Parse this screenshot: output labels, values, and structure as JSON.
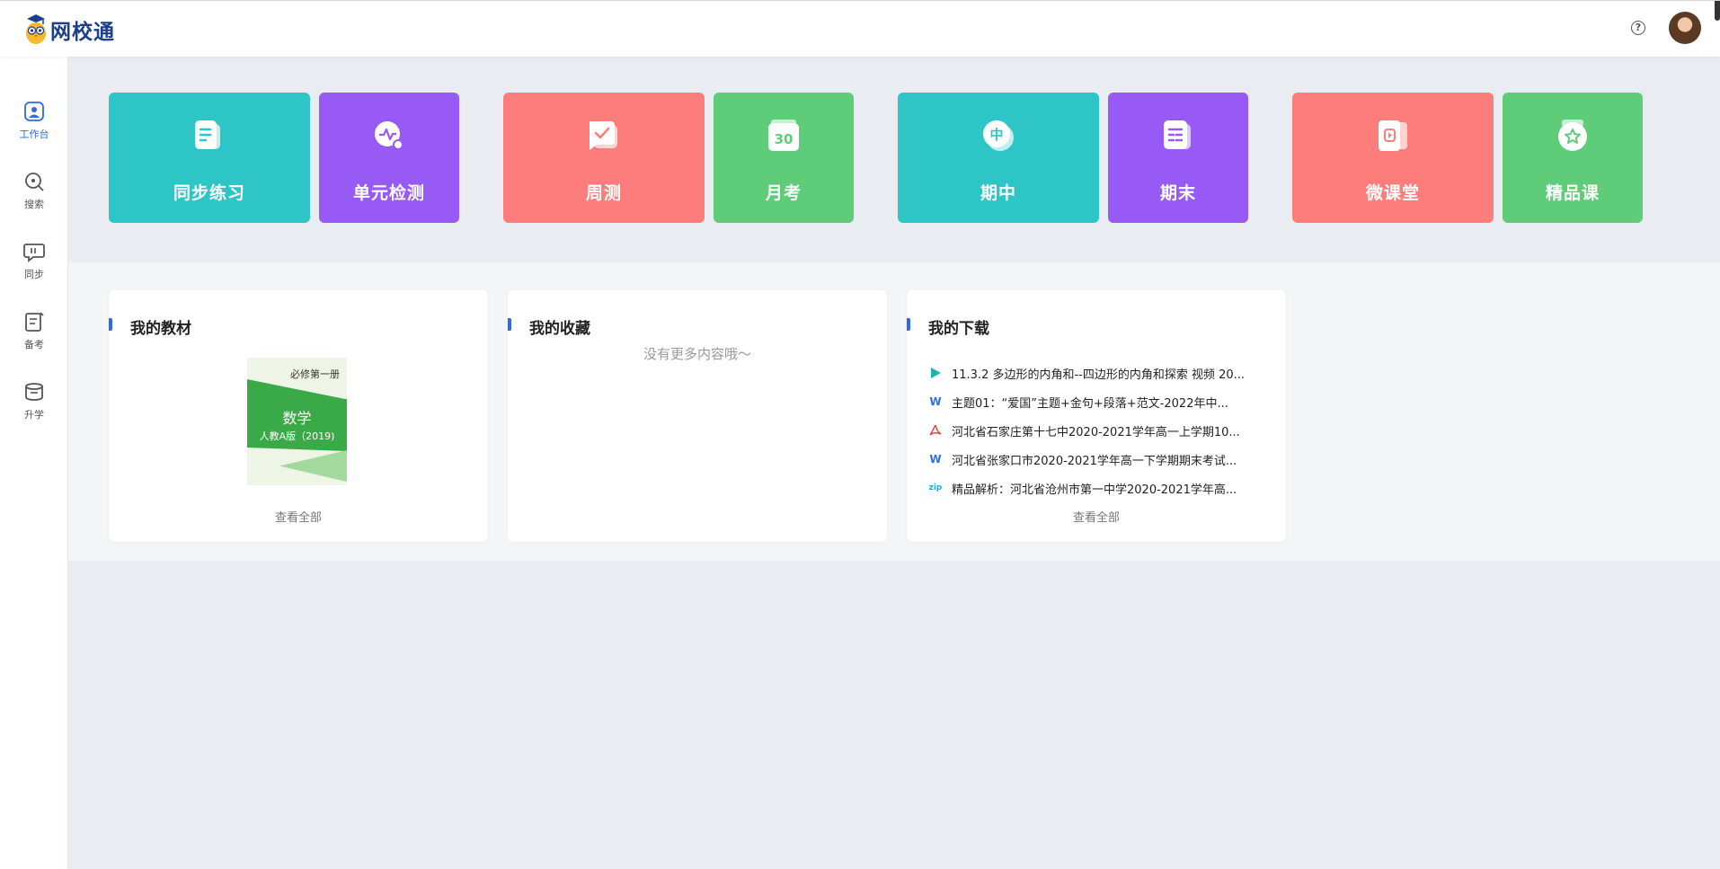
{
  "header": {
    "logo_text": "网校通",
    "help_glyph": "?"
  },
  "sidebar": {
    "items": [
      {
        "label": "工作台",
        "icon": "workbench-icon",
        "active": true
      },
      {
        "label": "搜索",
        "icon": "search-icon"
      },
      {
        "label": "同步",
        "icon": "sync-chat-icon"
      },
      {
        "label": "备考",
        "icon": "exam-prep-icon"
      },
      {
        "label": "升学",
        "icon": "graduation-icon"
      }
    ]
  },
  "tiles": [
    {
      "label": "同步练习",
      "color": "#2ec5c7",
      "icon": "document-icon"
    },
    {
      "label": "单元检测",
      "color": "#975af5",
      "icon": "chart-search-icon"
    },
    {
      "label": "周测",
      "color": "#fc7d7b",
      "icon": "checkmark-chat-icon"
    },
    {
      "label": "月考",
      "color": "#5fcc7a",
      "icon": "calendar-icon",
      "icon_text": "30"
    },
    {
      "label": "期中",
      "color": "#2ec5c7",
      "icon": "mid-term-icon",
      "icon_text": "中"
    },
    {
      "label": "期末",
      "color": "#975af5",
      "icon": "list-doc-icon"
    },
    {
      "label": "微课堂",
      "color": "#fc7d7b",
      "icon": "video-play-icon"
    },
    {
      "label": "精品课",
      "color": "#5fcc7a",
      "icon": "star-medal-icon"
    }
  ],
  "cards": {
    "textbook": {
      "title": "我的教材",
      "book": {
        "series": "必修第一册",
        "subject": "数学",
        "edition": "人教A版（2019)"
      },
      "more": "查看全部"
    },
    "favorites": {
      "title": "我的收藏",
      "empty": "没有更多内容哦～"
    },
    "downloads": {
      "title": "我的下载",
      "items": [
        {
          "type": "video",
          "text": "11.3.2 多边形的内角和--四边形的内角和探索 视频 20..."
        },
        {
          "type": "word",
          "text": "主题01：“爱国”主题+金句+段落+范文-2022年中..."
        },
        {
          "type": "pdf",
          "text": "河北省石家庄第十七中2020-2021学年高一上学期10..."
        },
        {
          "type": "word",
          "text": "河北省张家口市2020-2021学年高一下学期期末考试..."
        },
        {
          "type": "zip",
          "text": "精品解析：河北省沧州市第一中学2020-2021学年高..."
        }
      ],
      "more": "查看全部",
      "zip_label": "zip",
      "word_label": "W"
    }
  }
}
